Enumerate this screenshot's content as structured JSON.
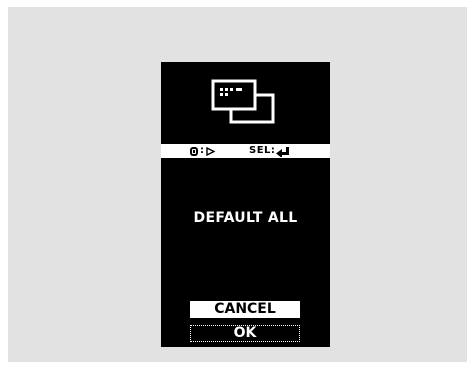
{
  "dialog": {
    "icon": "display-window-icon",
    "hints": {
      "left_icon": "jog-dial-icon",
      "left_text": ":",
      "left_arrow": "play-arrow-icon",
      "right_text": "SEL:",
      "right_arrow": "enter-arrow-icon"
    },
    "message": "DEFAULT ALL",
    "buttons": {
      "cancel": "CANCEL",
      "ok": "OK"
    }
  },
  "colors": {
    "background": "#e2e2e2",
    "screen": "#000000",
    "text": "#ffffff"
  }
}
